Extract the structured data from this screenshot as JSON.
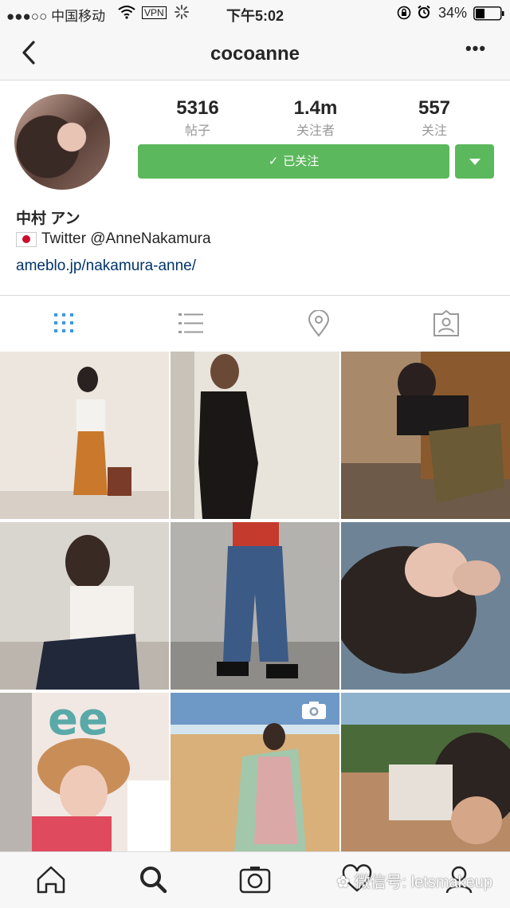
{
  "status_bar": {
    "carrier": "●●●○○ 中国移动",
    "vpn": "VPN",
    "time": "下午5:02",
    "battery": "34%"
  },
  "header": {
    "title": "cocoanne",
    "more": "•••"
  },
  "profile": {
    "stats": [
      {
        "value": "5316",
        "label": "帖子"
      },
      {
        "value": "1.4m",
        "label": "关注者"
      },
      {
        "value": "557",
        "label": "关注"
      }
    ],
    "follow_button": "已关注",
    "name": "中村 アン",
    "twitter": "Twitter @AnneNakamura",
    "link": "ameblo.jp/nakamura-anne/"
  },
  "tabs": [
    "grid-view",
    "list-view",
    "tagged-places",
    "tagged-photos"
  ],
  "watermark": "微信号: letsmakeup",
  "colors": {
    "accent_green": "#5cb85c",
    "active_tab_blue": "#3897f0",
    "link_blue": "#003569"
  }
}
